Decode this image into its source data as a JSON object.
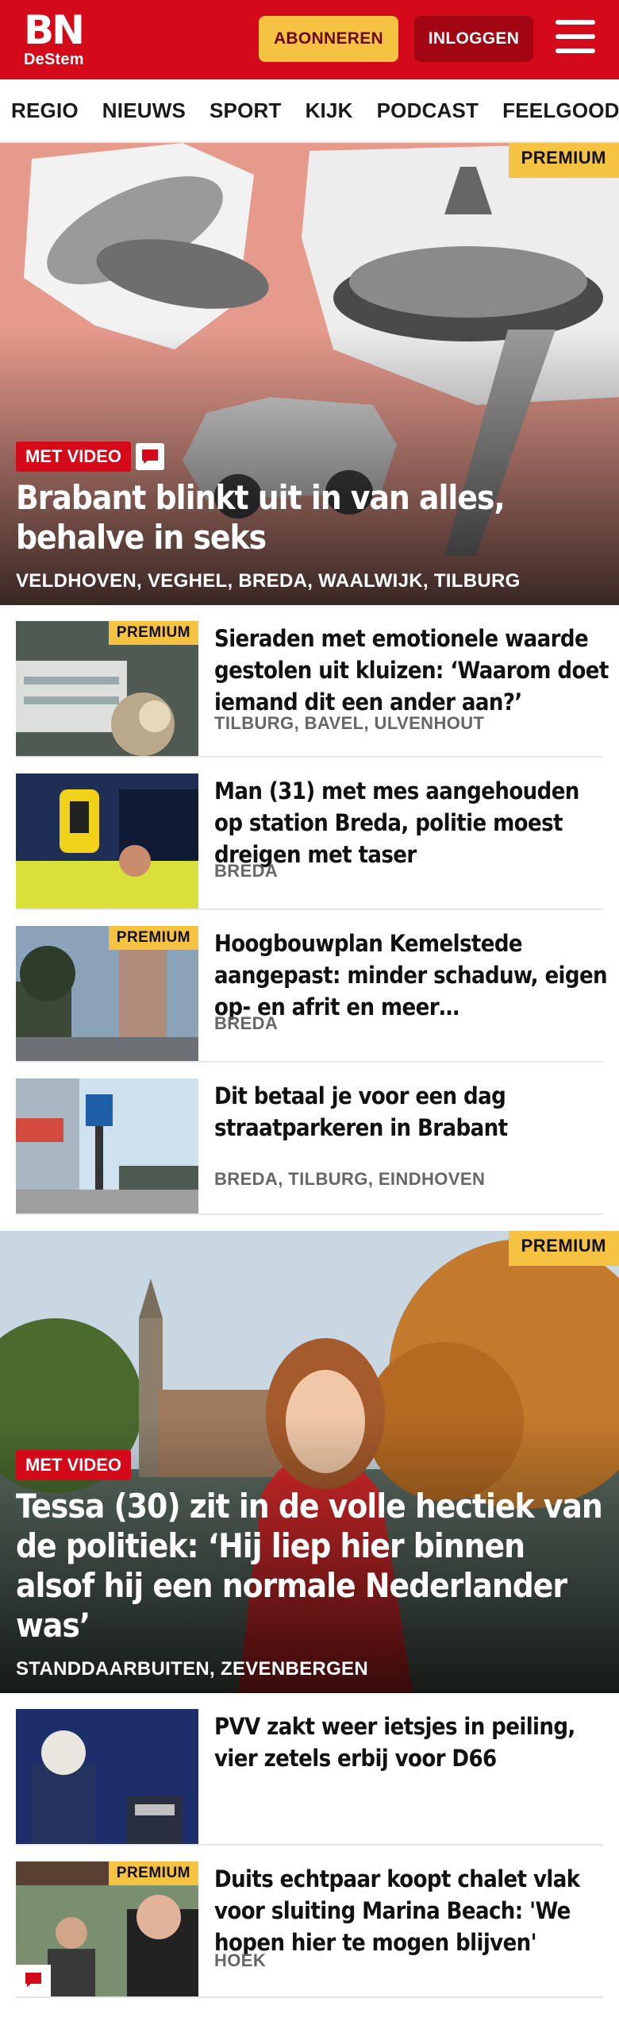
{
  "header": {
    "logo_main": "BN",
    "logo_sub": "DeStem",
    "subscribe_label": "ABONNEREN",
    "login_label": "INLOGGEN"
  },
  "nav": {
    "items": [
      "REGIO",
      "NIEUWS",
      "SPORT",
      "KIJK",
      "PODCAST",
      "FEELGOOD"
    ]
  },
  "colors": {
    "brand_red": "#d40a1a",
    "premium_yellow": "#f5c242",
    "login_dark_red": "#a10612"
  },
  "hero1": {
    "premium": "PREMIUM",
    "tag": "MET VIDEO",
    "has_comment_icon": "comment-icon",
    "title": "Brabant blinkt uit in van alles, behalve in seks",
    "locations": "VELDHOVEN, VEGHEL, BREDA, WAALWIJK, TILBURG"
  },
  "articles": [
    {
      "premium": "PREMIUM",
      "title": "Sieraden met emotionele waarde gestolen uit kluizen: ‘Waarom doet iemand dit een ander aan?’",
      "locations": "TILBURG, BAVEL, ULVENHOUT"
    },
    {
      "premium": "",
      "title": "Man (31) met mes aangehouden op station Breda, politie moest dreigen met taser",
      "locations": "BREDA"
    },
    {
      "premium": "PREMIUM",
      "title": "Hoogbouwplan Kemelstede aangepast: minder schaduw, eigen op- en afrit en meer…",
      "locations": "BREDA"
    },
    {
      "premium": "",
      "title": "Dit betaal je voor een dag straatparkeren in Brabant",
      "locations": "BREDA, TILBURG, EINDHOVEN"
    }
  ],
  "hero2": {
    "premium": "PREMIUM",
    "tag": "MET VIDEO",
    "title": "Tessa (30) zit in de volle hectiek van de politiek: ‘Hij liep hier binnen alsof hij een normale Nederlander was’",
    "locations": "STANDDAARBUITEN, ZEVENBERGEN"
  },
  "articles2": [
    {
      "premium": "",
      "title": "PVV zakt weer ietsjes in peiling, vier zetels erbij voor D66",
      "locations": ""
    },
    {
      "premium": "PREMIUM",
      "title": "Duits echtpaar koopt chalet vlak voor sluiting Marina Beach: 'We hopen hier te mogen blijven'",
      "locations": "HOEK"
    }
  ]
}
